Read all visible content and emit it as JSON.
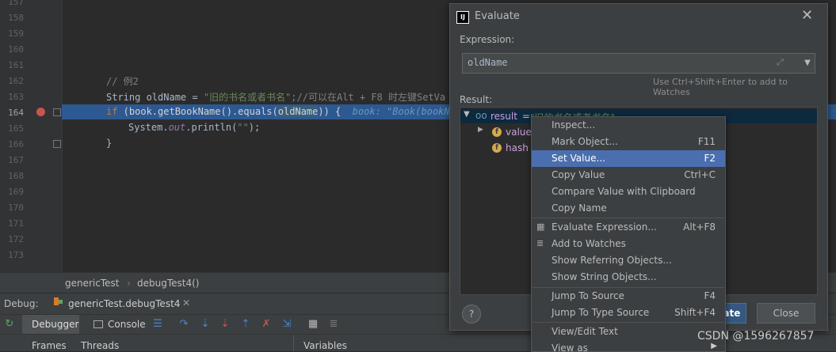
{
  "editor": {
    "gutter_lines": [
      "157",
      "158",
      "159",
      "160",
      "161",
      "162",
      "163",
      "164",
      "165",
      "166",
      "167",
      "168",
      "169",
      "170",
      "171",
      "172",
      "173"
    ],
    "current_line": "164",
    "code": {
      "l162_comment": "// 例2",
      "l163_type": "String ",
      "l163_var": "oldName",
      "l163_eq": " = ",
      "l163_str": "\"旧的书名或者书名\"",
      "l163_comment": ";//可以在Alt + F8 时左键SetVa",
      "l164_if": "if",
      "l164_code1": " (book.getBookName().equals(",
      "l164_var": "oldName",
      "l164_code2": ")) {",
      "l164_hint": "  book: \"Book(bookNam",
      "l165_sys": "System.",
      "l165_out": "out",
      "l165_rest": ".println(",
      "l165_str": "\"\"",
      "l165_end": ");",
      "l166_brace": "}"
    }
  },
  "breadcrumb": {
    "class_name": "genericTest",
    "method_name": "debugTest4()"
  },
  "debug": {
    "label": "Debug:",
    "session_tab": "genericTest.debugTest4",
    "tab_debugger": "Debugger",
    "tab_console": "Console",
    "frames": "Frames",
    "threads": "Threads",
    "variables": "Variables"
  },
  "dialog": {
    "title": "Evaluate",
    "title_icon_text": "IJ",
    "expression_label": "Expression:",
    "expression_value": "oldName",
    "watches_hint": "Use Ctrl+Shift+Enter to add to Watches",
    "result_label": "Result:",
    "result_row": {
      "name": "result",
      "eq": " = ",
      "value": "\"旧的书名或者书名\""
    },
    "children": [
      {
        "name": "value"
      },
      {
        "name": "hash"
      }
    ],
    "field_badge": "f",
    "help_label": "?",
    "evaluate_label": "Evaluate",
    "close_label": "Close"
  },
  "context_menu": {
    "items": [
      {
        "label": "Inspect...",
        "shortcut": ""
      },
      {
        "label": "Mark Object...",
        "shortcut": "F11"
      },
      {
        "label": "Set Value...",
        "shortcut": "F2"
      },
      {
        "label": "Copy Value",
        "shortcut": "Ctrl+C"
      },
      {
        "label": "Compare Value with Clipboard",
        "shortcut": ""
      },
      {
        "label": "Copy Name",
        "shortcut": ""
      },
      {
        "label": "Evaluate Expression...",
        "shortcut": "Alt+F8"
      },
      {
        "label": "Add to Watches",
        "shortcut": ""
      },
      {
        "label": "Show Referring Objects...",
        "shortcut": ""
      },
      {
        "label": "Show String Objects...",
        "shortcut": ""
      },
      {
        "label": "Jump To Source",
        "shortcut": "F4"
      },
      {
        "label": "Jump To Type Source",
        "shortcut": "Shift+F4"
      },
      {
        "label": "View/Edit Text",
        "shortcut": ""
      },
      {
        "label": "View as",
        "shortcut": ""
      }
    ],
    "selected": "Set Value..."
  },
  "watermark": "CSDN @1596267857",
  "colors": {
    "selection": "#4b6eaf",
    "current_line": "#2d5992",
    "breakpoint": "#c75450",
    "string": "#6a8759",
    "keyword": "#cc7832"
  }
}
